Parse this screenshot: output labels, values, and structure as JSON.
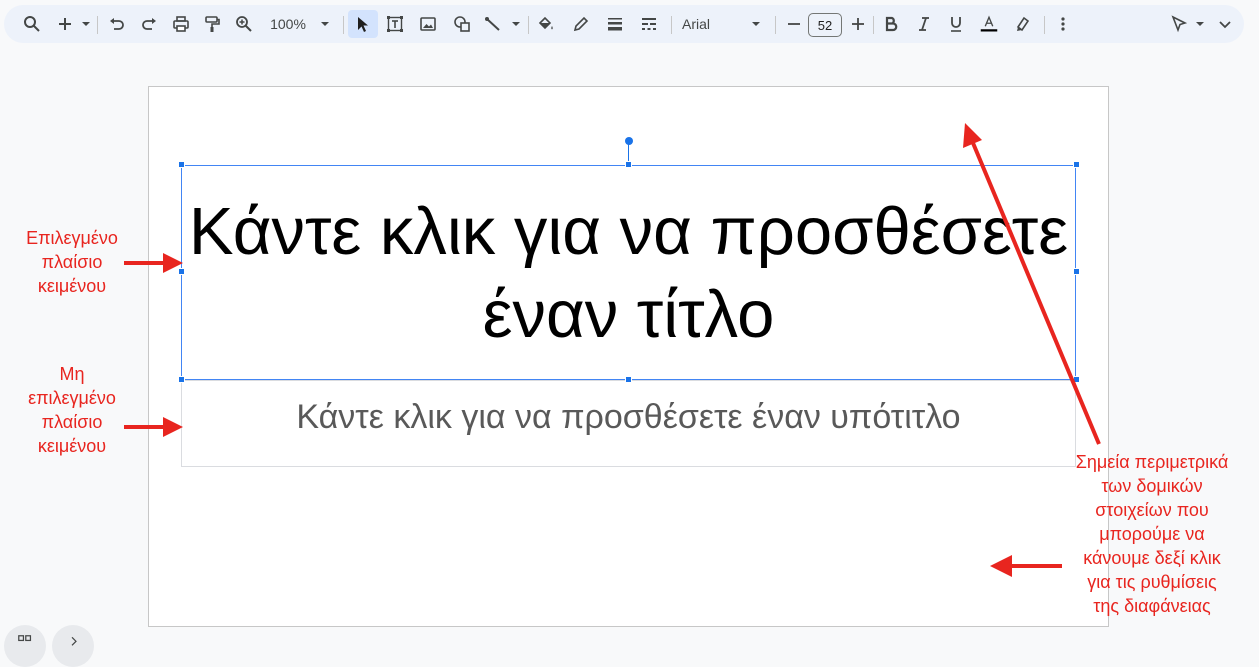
{
  "toolbar": {
    "zoom": "100%",
    "font": "Arial",
    "font_size": "52",
    "text_color_bar": "#000000",
    "accent": "#1a73e8"
  },
  "slide": {
    "title": "Κάντε κλικ για να προσθέσετε έναν τίτλο",
    "subtitle": "Κάντε κλικ για να προσθέσετε έναν υπότιτλο"
  },
  "annotations": {
    "selected": [
      "Επιλεγμένο",
      "πλαίσιο",
      "κειμένου"
    ],
    "unselected": [
      "Μη",
      "επιλεγμένο",
      "πλαίσιο",
      "κειμένου"
    ],
    "points": [
      "Σημεία περιμετρικά",
      "των δομικών",
      "στοιχείων που",
      "μπορούμε να",
      "κάνουμε δεξί κλικ",
      "για τις ρυθμίσεις",
      "της διαφάνειας"
    ],
    "color": "#e8251f"
  }
}
